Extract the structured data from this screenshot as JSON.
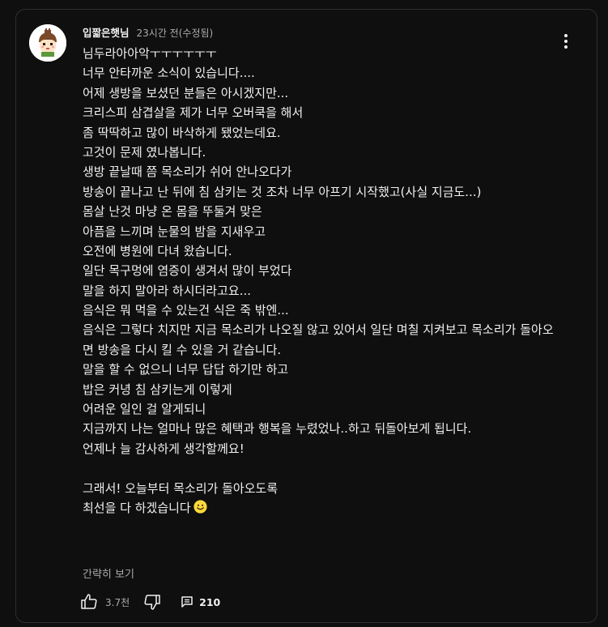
{
  "comment": {
    "author": "입짧은햇님",
    "timestamp": "23시간 전(수정됨)",
    "lines": [
      "님두라아아악ㅜㅜㅜㅜㅜㅜ",
      "너무 안타까운 소식이 있습니다....",
      "어제 생방을 보셨던 분들은 아시겠지만...",
      "크리스피 삼겹살을 제가 너무 오버쿡을 해서",
      "좀 딱딱하고 많이 바삭하게 됐었는데요.",
      "고것이 문제 였나봅니다.",
      "생방 끝날때 쯤 목소리가 쉬어 안나오다가",
      "방송이 끝나고 난 뒤에 침 삼키는 것 조차 너무 아프기 시작했고(사실 지금도...)",
      "몸살 난것 마냥 온 몸을 뚜둘겨 맞은",
      "아픔을 느끼며 눈물의 밤을 지새우고",
      "오전에 병원에 다녀 왔습니다.",
      "일단 목구멍에 염증이 생겨서 많이 부었다",
      "말을 하지 말아라 하시더라고요...",
      "음식은 뭐 먹을 수 있는건 식은 죽 밖엔...",
      "음식은 그렇다 치지만 지금 목소리가 나오질 않고 있어서 일단 며칠 지켜보고 목소리가 돌아오면 방송을 다시 킬 수 있을 거 같습니다.",
      "말을 할 수 없으니 너무 답답 하기만 하고",
      "밥은 커녕 침 삼키는게 이렇게",
      "어려운 일인 걸  알게되니",
      "지금까지 나는 얼마나 많은 혜택과 행복을 누렸었나..하고 뒤돌아보게 됩니다.",
      "언제나 늘 감사하게 생각할께요!",
      "",
      "그래서! 오늘부터 목소리가 돌아오도록",
      "최선을 다 하겠습니다"
    ],
    "show_less": "간략히 보기",
    "like_count": "3.7천",
    "reply_count": "210"
  },
  "icons": {
    "avatar": "character-face-avatar",
    "menu": "more-vertical-icon",
    "emoji": "smiling-face-emoji",
    "like": "thumbs-up-icon",
    "dislike": "thumbs-down-icon",
    "replies": "comment-replies-icon"
  },
  "colors": {
    "background": "#0f0f0f",
    "border": "#2f2f2f",
    "text": "#f1f1f1",
    "secondary": "#aaaaaa",
    "emoji": "#ffd93b"
  }
}
